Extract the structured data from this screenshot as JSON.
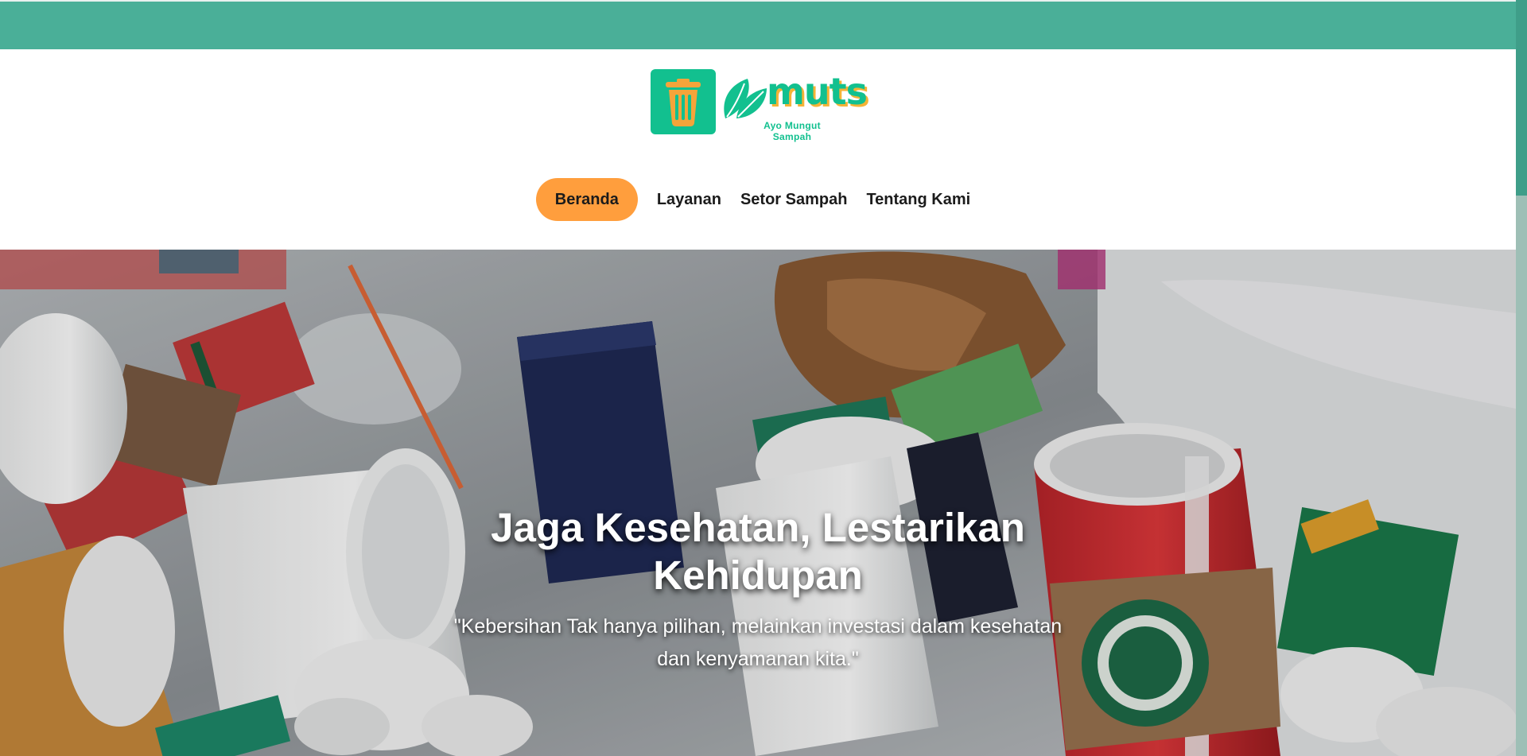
{
  "brand": {
    "wordmark": "muts",
    "tagline": "Ayo Mungut Sampah",
    "logo_icon": "trash-bin-icon",
    "leaf_icon": "leaf-icon"
  },
  "colors": {
    "topbar": "#4aaf98",
    "brand_green": "#12c08f",
    "accent_orange": "#ff9e3d",
    "wordmark_shadow": "#f5b335"
  },
  "nav": {
    "items": [
      {
        "label": "Beranda",
        "active": true
      },
      {
        "label": "Layanan",
        "active": false
      },
      {
        "label": "Setor Sampah",
        "active": false
      },
      {
        "label": "Tentang Kami",
        "active": false
      }
    ]
  },
  "hero": {
    "title_line1": "Jaga Kesehatan, Lestarikan",
    "title_line2": "Kehidupan",
    "quote_line1": "\"Kebersihan Tak hanya pilihan, melainkan investasi dalam kesehatan",
    "quote_line2": "dan kenyamanan kita.\"",
    "background": "plastic-cups-trash-photo"
  }
}
